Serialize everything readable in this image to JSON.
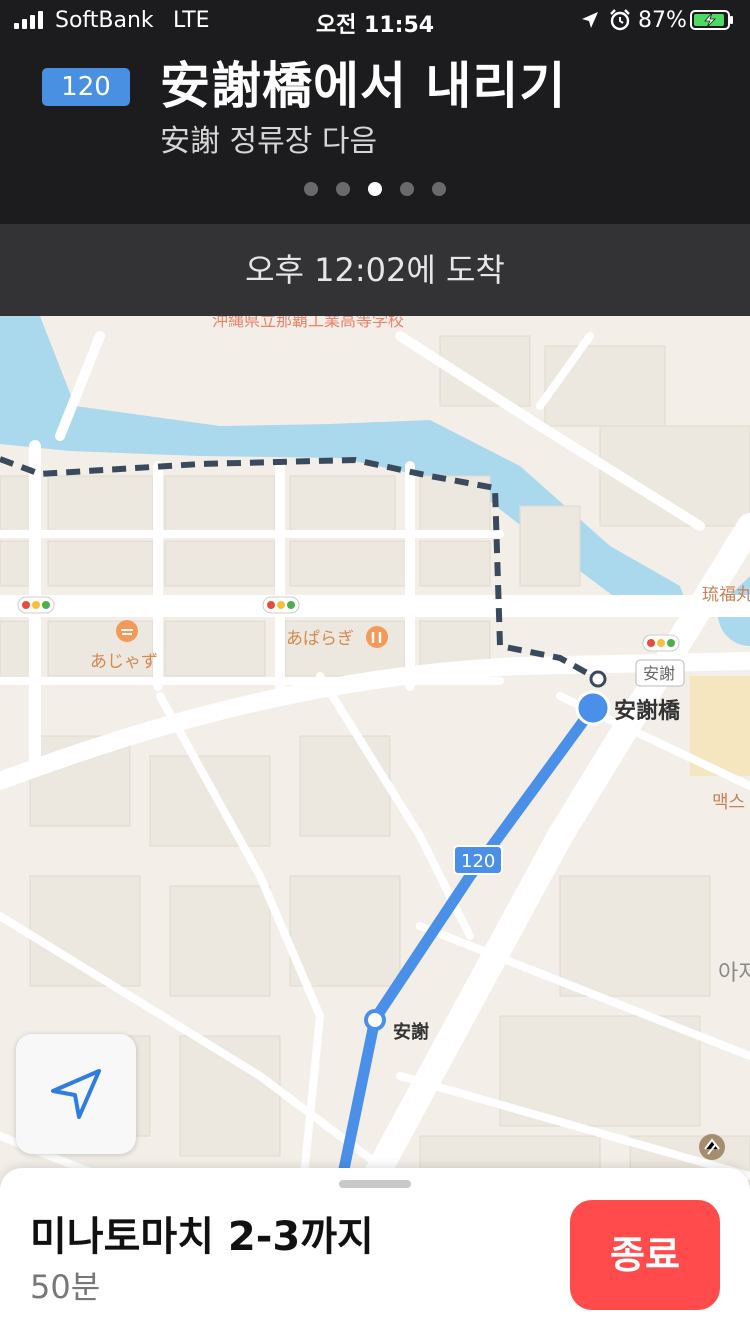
{
  "status_bar": {
    "carrier": "SoftBank",
    "network": "LTE",
    "time": "오전 11:54",
    "battery": "87%"
  },
  "header": {
    "route_badge": "120",
    "instruction": "安謝橋에서 내리기",
    "sub_instruction": "安謝 정류장 다음",
    "page_count": 5,
    "active_page": 3
  },
  "arrival": "오후 12:02에 도착",
  "map": {
    "poi": {
      "school": "沖縄県立那覇工業高等学校",
      "restaurant1": "あじゃず",
      "restaurant2": "あぱらぎ",
      "ryufuku": "琉福丸",
      "area_sign": "安謝",
      "max": "맥스",
      "right_edge": "아저"
    },
    "stops": {
      "destination": "安謝橋",
      "intermediate": "安謝"
    },
    "route_label": "120"
  },
  "colors": {
    "route": "#4a8fe8",
    "walk": "#3a4a5c",
    "water": "#aad8ec",
    "end_button": "#ff4b4b"
  },
  "bottom": {
    "destination": "미나토마치 2-3까지",
    "duration": "50분",
    "end_label": "종료"
  }
}
